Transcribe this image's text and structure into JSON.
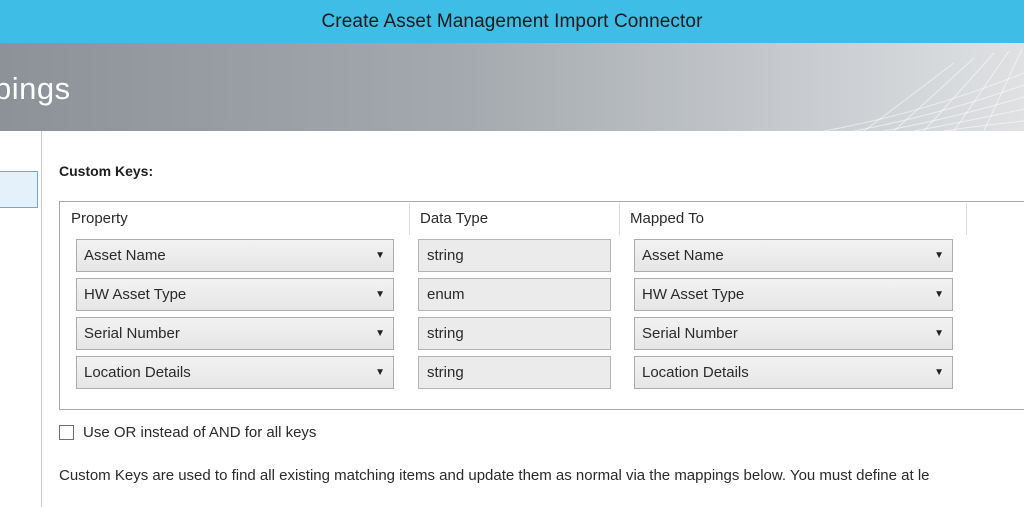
{
  "window": {
    "title": "Create Asset Management Import Connector"
  },
  "page": {
    "heading": "pings"
  },
  "custom_keys": {
    "section_title": "Custom Keys:",
    "columns": {
      "property": "Property",
      "data_type": "Data Type",
      "mapped_to": "Mapped To"
    },
    "rows": [
      {
        "property": "Asset Name",
        "data_type": "string",
        "mapped_to": "Asset Name"
      },
      {
        "property": "HW Asset Type",
        "data_type": "enum",
        "mapped_to": "HW Asset Type"
      },
      {
        "property": "Serial Number",
        "data_type": "string",
        "mapped_to": "Serial Number"
      },
      {
        "property": "Location Details",
        "data_type": "string",
        "mapped_to": "Location Details"
      }
    ],
    "use_or_label": "Use OR instead of AND for all keys",
    "use_or_checked": false,
    "description": "Custom Keys are used to find all existing matching items and update them as normal via the mappings below. You must define at le"
  },
  "colors": {
    "title_bar": "#3ebde6",
    "header_gradient_start": "#8c9298",
    "header_gradient_end": "#dfe1e3",
    "selection_border": "#6fa9d4"
  }
}
